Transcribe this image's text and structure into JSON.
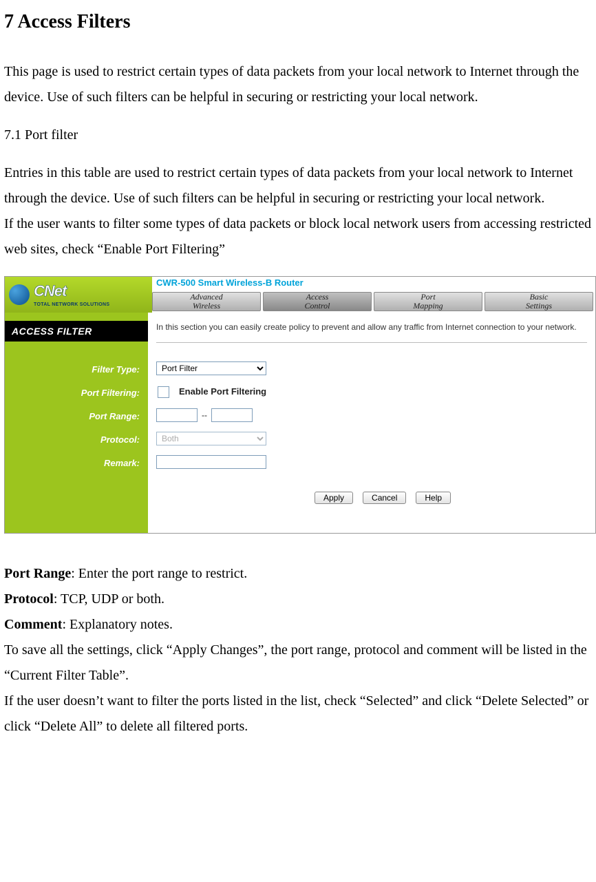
{
  "doc": {
    "heading": "7    Access Filters",
    "intro": "This page is used to restrict certain types of data packets from your local network to Internet through the device. Use of such filters can be helpful in securing or restricting your local network.",
    "sub_heading": "7.1 Port filter",
    "sub_para1": "Entries in this table are used to restrict certain types of data packets from your local network to Internet through the device. Use of such filters can be helpful in securing or restricting your local network.",
    "sub_para2": "If the user wants to filter some types of data packets or block local network users from accessing restricted web sites, check “Enable Port Filtering”",
    "defs": {
      "port_range_label": "Port Range",
      "port_range_text": ": Enter the port range to restrict.",
      "protocol_label": "Protocol",
      "protocol_text": ": TCP, UDP or both.",
      "comment_label": "Comment",
      "comment_text": ": Explanatory notes."
    },
    "after1": "To save all the settings, click “Apply Changes”, the port range, protocol and comment will be listed in the “Current Filter Table”.",
    "after2": "If the user doesn’t want to filter the ports listed in the list, check “Selected” and click “Delete Selected” or click “Delete All” to delete all filtered ports."
  },
  "screenshot": {
    "logo": {
      "brand": "CNet",
      "tagline": "TOTAL NETWORK SOLUTIONS"
    },
    "model": "CWR-500 Smart Wireless-B Router",
    "tabs": [
      "Advanced\nWireless",
      "Access\nControl",
      "Port\nMapping",
      "Basic\nSettings"
    ],
    "active_tab_index": 1,
    "sidebar": {
      "title": "ACCESS FILTER",
      "labels": {
        "filter_type": "Filter Type:",
        "port_filtering": "Port Filtering:",
        "port_range": "Port Range:",
        "protocol": "Protocol:",
        "remark": "Remark:"
      }
    },
    "content": {
      "description": "In this section you can easily create policy to prevent and allow any traffic from Internet connection to your network.",
      "filter_type_value": "Port Filter",
      "enable_label": "Enable Port Filtering",
      "port_from": "",
      "port_sep": "--",
      "port_to": "",
      "protocol_value": "Both",
      "remark_value": "",
      "buttons": {
        "apply": "Apply",
        "cancel": "Cancel",
        "help": "Help"
      }
    }
  }
}
